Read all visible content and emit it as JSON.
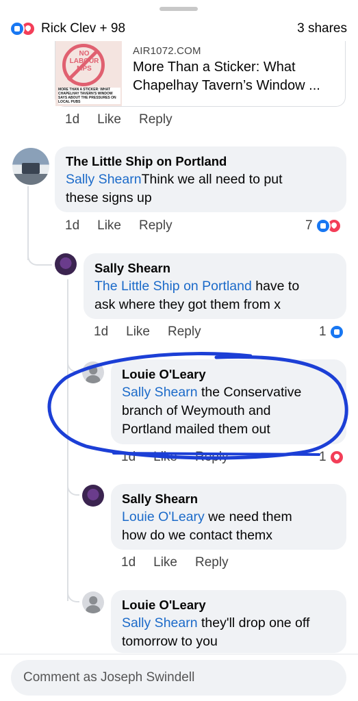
{
  "header": {
    "reactors": "Rick Clev + 98",
    "shares": "3 shares"
  },
  "link_preview": {
    "domain": "AIR1072.COM",
    "title_line1": "More Than a Sticker: What",
    "title_line2": "Chapelhay Tavern’s Window ...",
    "thumb_sign_top": "NO",
    "thumb_sign_mid": "LABOUR",
    "thumb_sign_bottom": "MPS",
    "thumb_caption": "MORE THAN A STICKER: WHAT CHAPELHAY TAVERN'S WINDOW SAYS ABOUT THE PRESSURES ON LOCAL PUBS"
  },
  "actions": {
    "time": "1d",
    "like": "Like",
    "reply": "Reply"
  },
  "comments": [
    {
      "author": "The Little Ship on Portland",
      "mention": "Sally Shearn",
      "text_line1": "Think we all need to put",
      "text_line2": "these signs up",
      "time": "1d",
      "reaction_count": "7"
    },
    {
      "author": "Sally Shearn",
      "mention": "The Little Ship on Portland",
      "text_line1": " have to",
      "text_line2": "ask where they got them from x",
      "time": "1d",
      "reaction_count": "1"
    },
    {
      "author": "Louie O'Leary",
      "mention": "Sally Shearn",
      "text_line1": " the Conservative",
      "text_line2": "branch of Weymouth and",
      "text_line3": "Portland mailed them out",
      "time": "1d",
      "reaction_count": "1"
    },
    {
      "author": "Sally Shearn",
      "mention": "Louie O'Leary",
      "text_line1": " we need them",
      "text_line2": "how do we contact themx",
      "time": "1d"
    },
    {
      "author": "Louie O'Leary",
      "mention": "Sally Shearn",
      "text_line1": " they'll drop one off",
      "text_line2": "tomorrow to you"
    }
  ],
  "composer": {
    "placeholder": "Comment as Joseph Swindell"
  },
  "colors": {
    "like_blue": "#1877f2",
    "love_red": "#f33e58",
    "mention_blue": "#1b6ac9",
    "annotation_blue": "#1c3fd6"
  }
}
